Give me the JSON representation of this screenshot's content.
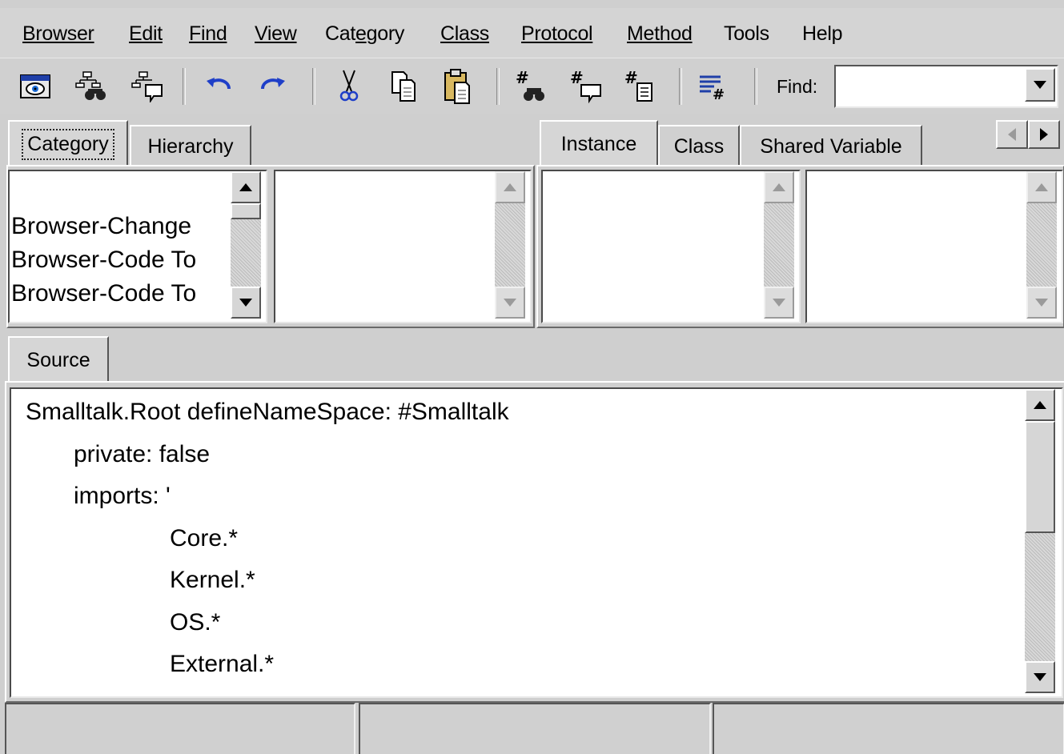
{
  "menu": [
    "Browser",
    "Edit",
    "Find",
    "View",
    "Category",
    "Class",
    "Protocol",
    "Method",
    "Tools",
    "Help"
  ],
  "menu_mnemonic_index": [
    0,
    0,
    0,
    0,
    3,
    0,
    0,
    0,
    -1,
    -1
  ],
  "toolbar": {
    "icons": [
      "browser-window-icon",
      "find-class-icon",
      "find-class-references-icon",
      "undo-icon",
      "redo-icon",
      "cut-icon",
      "copy-icon",
      "paste-icon",
      "find-method-icon",
      "find-method-references-icon",
      "method-list-icon",
      "format-source-icon"
    ],
    "find_label": "Find:",
    "find_value": ""
  },
  "left_tabs": [
    "Category",
    "Hierarchy"
  ],
  "right_tabs": [
    "Instance",
    "Class",
    "Shared Variable"
  ],
  "category_list": [
    "Browser-Change",
    "Browser-Code To",
    "Browser-Code To"
  ],
  "source_tab": "Source",
  "source_lines": [
    {
      "indent": 0,
      "text": "Smalltalk.Root defineNameSpace: #Smalltalk"
    },
    {
      "indent": 1,
      "text": "private: false"
    },
    {
      "indent": 1,
      "text": "imports: '"
    },
    {
      "indent": 2,
      "text": "Core.*"
    },
    {
      "indent": 2,
      "text": "Kernel.*"
    },
    {
      "indent": 2,
      "text": "OS.*"
    },
    {
      "indent": 2,
      "text": "External.*"
    }
  ],
  "colors": {
    "window_bg": "#cfcfcf",
    "list_bg": "#ffffff",
    "text": "#000000"
  }
}
